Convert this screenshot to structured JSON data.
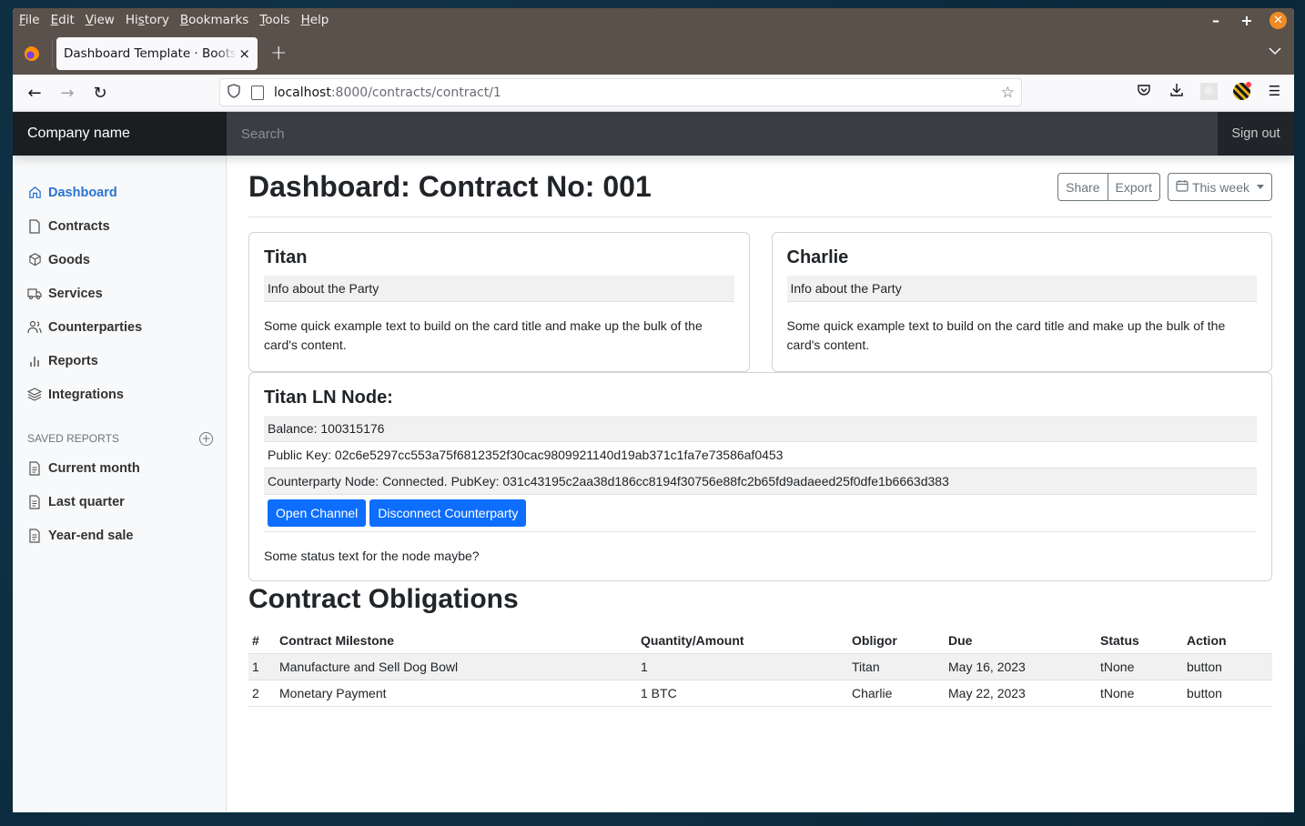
{
  "browser": {
    "menu": [
      "File",
      "Edit",
      "View",
      "History",
      "Bookmarks",
      "Tools",
      "Help"
    ],
    "menu_underlines": [
      "F",
      "E",
      "V",
      "s",
      "B",
      "T",
      "H"
    ],
    "tab_title": "Dashboard Template · Bootstrap",
    "url_host": "localhost",
    "url_path": ":8000/contracts/contract/1"
  },
  "header": {
    "brand": "Company name",
    "search_placeholder": "Search",
    "signout": "Sign out"
  },
  "sidebar": {
    "items": [
      {
        "label": "Dashboard",
        "icon": "house-icon",
        "active": true
      },
      {
        "label": "Contracts",
        "icon": "file-icon"
      },
      {
        "label": "Goods",
        "icon": "box-icon"
      },
      {
        "label": "Services",
        "icon": "truck-icon"
      },
      {
        "label": "Counterparties",
        "icon": "people-icon"
      },
      {
        "label": "Reports",
        "icon": "bar-chart-icon"
      },
      {
        "label": "Integrations",
        "icon": "layers-icon"
      }
    ],
    "saved_reports_heading": "Saved reports",
    "saved_reports": [
      {
        "label": "Current month",
        "icon": "file-text-icon"
      },
      {
        "label": "Last quarter",
        "icon": "file-text-icon"
      },
      {
        "label": "Year-end sale",
        "icon": "file-text-icon"
      }
    ]
  },
  "page": {
    "title": "Dashboard: Contract No: 001",
    "share": "Share",
    "export": "Export",
    "period": "This week"
  },
  "parties": [
    {
      "name": "Titan",
      "info": "Info about the Party",
      "text": "Some quick example text to build on the card title and make up the bulk of the card's content."
    },
    {
      "name": "Charlie",
      "info": "Info about the Party",
      "text": "Some quick example text to build on the card title and make up the bulk of the card's content."
    }
  ],
  "node": {
    "title": "Titan LN Node:",
    "balance": "Balance: 100315176",
    "public_key": "Public Key: 02c6e5297cc553a75f6812352f30cac9809921140d19ab371c1fa7e73586af0453",
    "counterparty": "Counterparty Node: Connected. PubKey: 031c43195c2aa38d186cc8194f30756e88fc2b65fd9adaeed25f0dfe1b6663d383",
    "open_channel": "Open Channel",
    "disconnect": "Disconnect Counterparty",
    "status": "Some status text for the node maybe?"
  },
  "obligations": {
    "title": "Contract Obligations",
    "columns": [
      "#",
      "Contract Milestone",
      "Quantity/Amount",
      "Obligor",
      "Due",
      "Status",
      "Action"
    ],
    "rows": [
      [
        "1",
        "Manufacture and Sell Dog Bowl",
        "1",
        "Titan",
        "May 16, 2023",
        "tNone",
        "button"
      ],
      [
        "2",
        "Monetary Payment",
        "1 BTC",
        "Charlie",
        "May 22, 2023",
        "tNone",
        "button"
      ]
    ]
  }
}
